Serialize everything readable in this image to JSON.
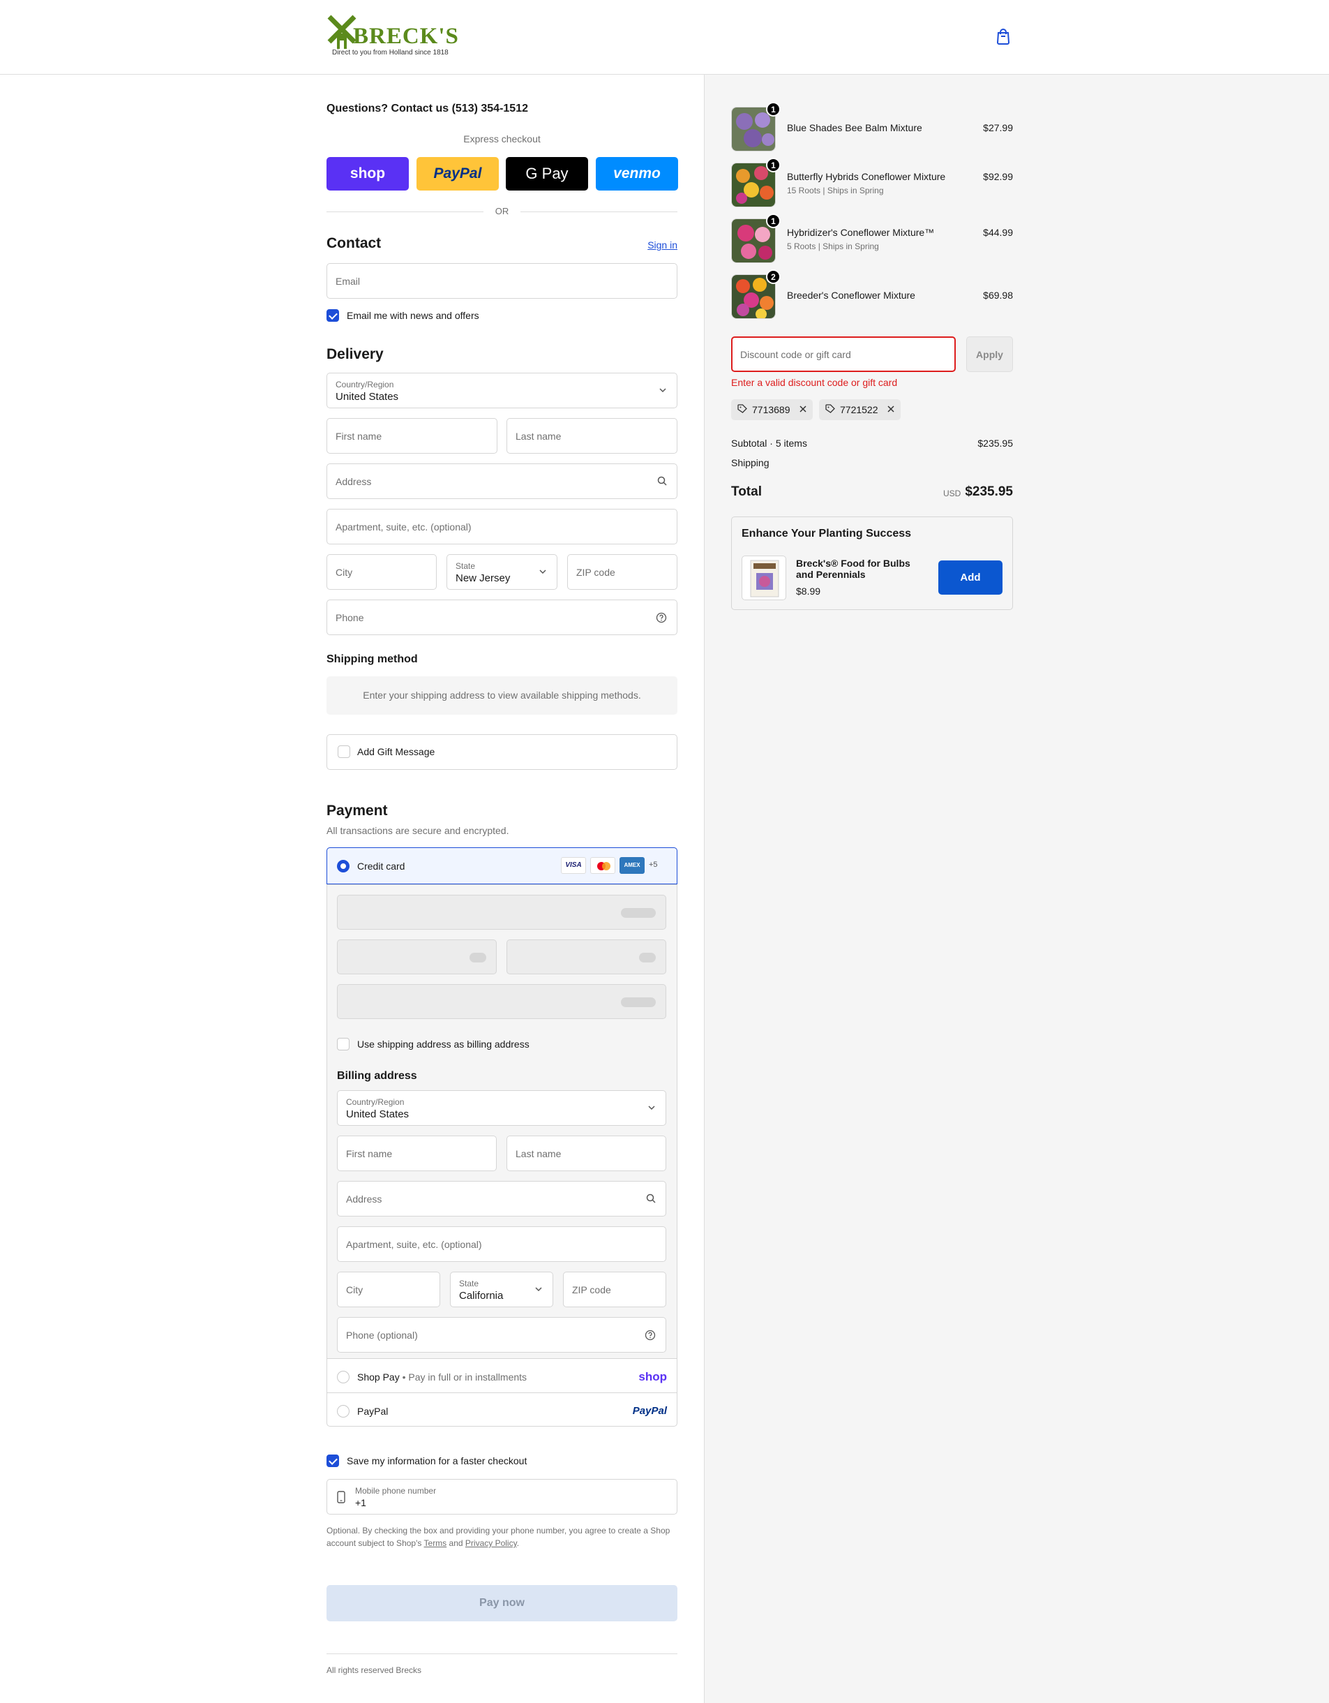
{
  "header": {
    "brand": "BRECK'S",
    "tagline": "Direct to you from Holland since 1818"
  },
  "contact_line": "Questions? Contact us (513) 354-1512",
  "express": {
    "label": "Express checkout",
    "or": "OR",
    "buttons": [
      {
        "name": "shop",
        "label": "shop",
        "bg": "#5a31f4"
      },
      {
        "name": "paypal",
        "label": "PayPal",
        "bg": "#ffc439"
      },
      {
        "name": "gpay",
        "label": "G Pay",
        "bg": "#000000"
      },
      {
        "name": "venmo",
        "label": "venmo",
        "bg": "#008cff"
      }
    ]
  },
  "contact": {
    "heading": "Contact",
    "sign_in": "Sign in",
    "email_placeholder": "Email",
    "news_checkbox": "Email me with news and offers"
  },
  "delivery": {
    "heading": "Delivery",
    "country_label": "Country/Region",
    "country_value": "United States",
    "first_name": "First name",
    "last_name": "Last name",
    "address": "Address",
    "apartment": "Apartment, suite, etc. (optional)",
    "city": "City",
    "state_label": "State",
    "state_value": "New Jersey",
    "zip": "ZIP code",
    "phone": "Phone"
  },
  "shipping": {
    "heading": "Shipping method",
    "notice": "Enter your shipping address to view available shipping methods."
  },
  "gift": {
    "label": "Add Gift Message"
  },
  "payment": {
    "heading": "Payment",
    "subtitle": "All transactions are secure and encrypted.",
    "credit_card": "Credit card",
    "more_cards": "+5",
    "billing_same": "Use shipping address as billing address",
    "billing_heading": "Billing address",
    "billing": {
      "country_label": "Country/Region",
      "country_value": "United States",
      "first_name": "First name",
      "last_name": "Last name",
      "address": "Address",
      "apartment": "Apartment, suite, etc. (optional)",
      "city": "City",
      "state_label": "State",
      "state_value": "California",
      "zip": "ZIP code",
      "phone": "Phone (optional)"
    },
    "shop_pay": "Shop Pay",
    "shop_pay_sub": "Pay in full or in installments",
    "shop_logo": "shop",
    "paypal": "PayPal",
    "paypal_logo": "PayPal"
  },
  "save_info": {
    "label": "Save my information for a faster checkout",
    "phone_label": "Mobile phone number",
    "phone_value": "+1",
    "disclaimer_1": "Optional. By checking the box and providing your phone number, you agree to create a Shop account subject to Shop's",
    "terms": "Terms",
    "and": "and",
    "privacy": "Privacy Policy",
    "period": "."
  },
  "pay_now": "Pay now",
  "footer": "All rights reserved Brecks",
  "cart": {
    "items": [
      {
        "name": "Blue Shades Bee Balm Mixture",
        "sub": "",
        "qty": "1",
        "price": "$27.99"
      },
      {
        "name": "Butterfly Hybrids Coneflower Mixture",
        "sub": "15 Roots | Ships in Spring",
        "qty": "1",
        "price": "$92.99"
      },
      {
        "name": "Hybridizer's Coneflower Mixture™",
        "sub": "5 Roots | Ships in Spring",
        "qty": "1",
        "price": "$44.99"
      },
      {
        "name": "Breeder's Coneflower Mixture",
        "sub": "",
        "qty": "2",
        "price": "$69.98"
      }
    ],
    "discount_placeholder": "Discount code or gift card",
    "apply": "Apply",
    "discount_error": "Enter a valid discount code or gift card",
    "codes": [
      "7713689",
      "7721522"
    ],
    "subtotal_label": "Subtotal · 5 items",
    "subtotal_value": "$235.95",
    "shipping_label": "Shipping",
    "total_label": "Total",
    "currency": "USD",
    "total_value": "$235.95"
  },
  "upsell": {
    "heading": "Enhance Your Planting Success",
    "product": "Breck's® Food for Bulbs and Perennials",
    "price": "$8.99",
    "add": "Add"
  },
  "colors": {
    "accent": "#1d4ed8",
    "error": "#dd1d1d",
    "brand_green": "#5b8a1c"
  }
}
